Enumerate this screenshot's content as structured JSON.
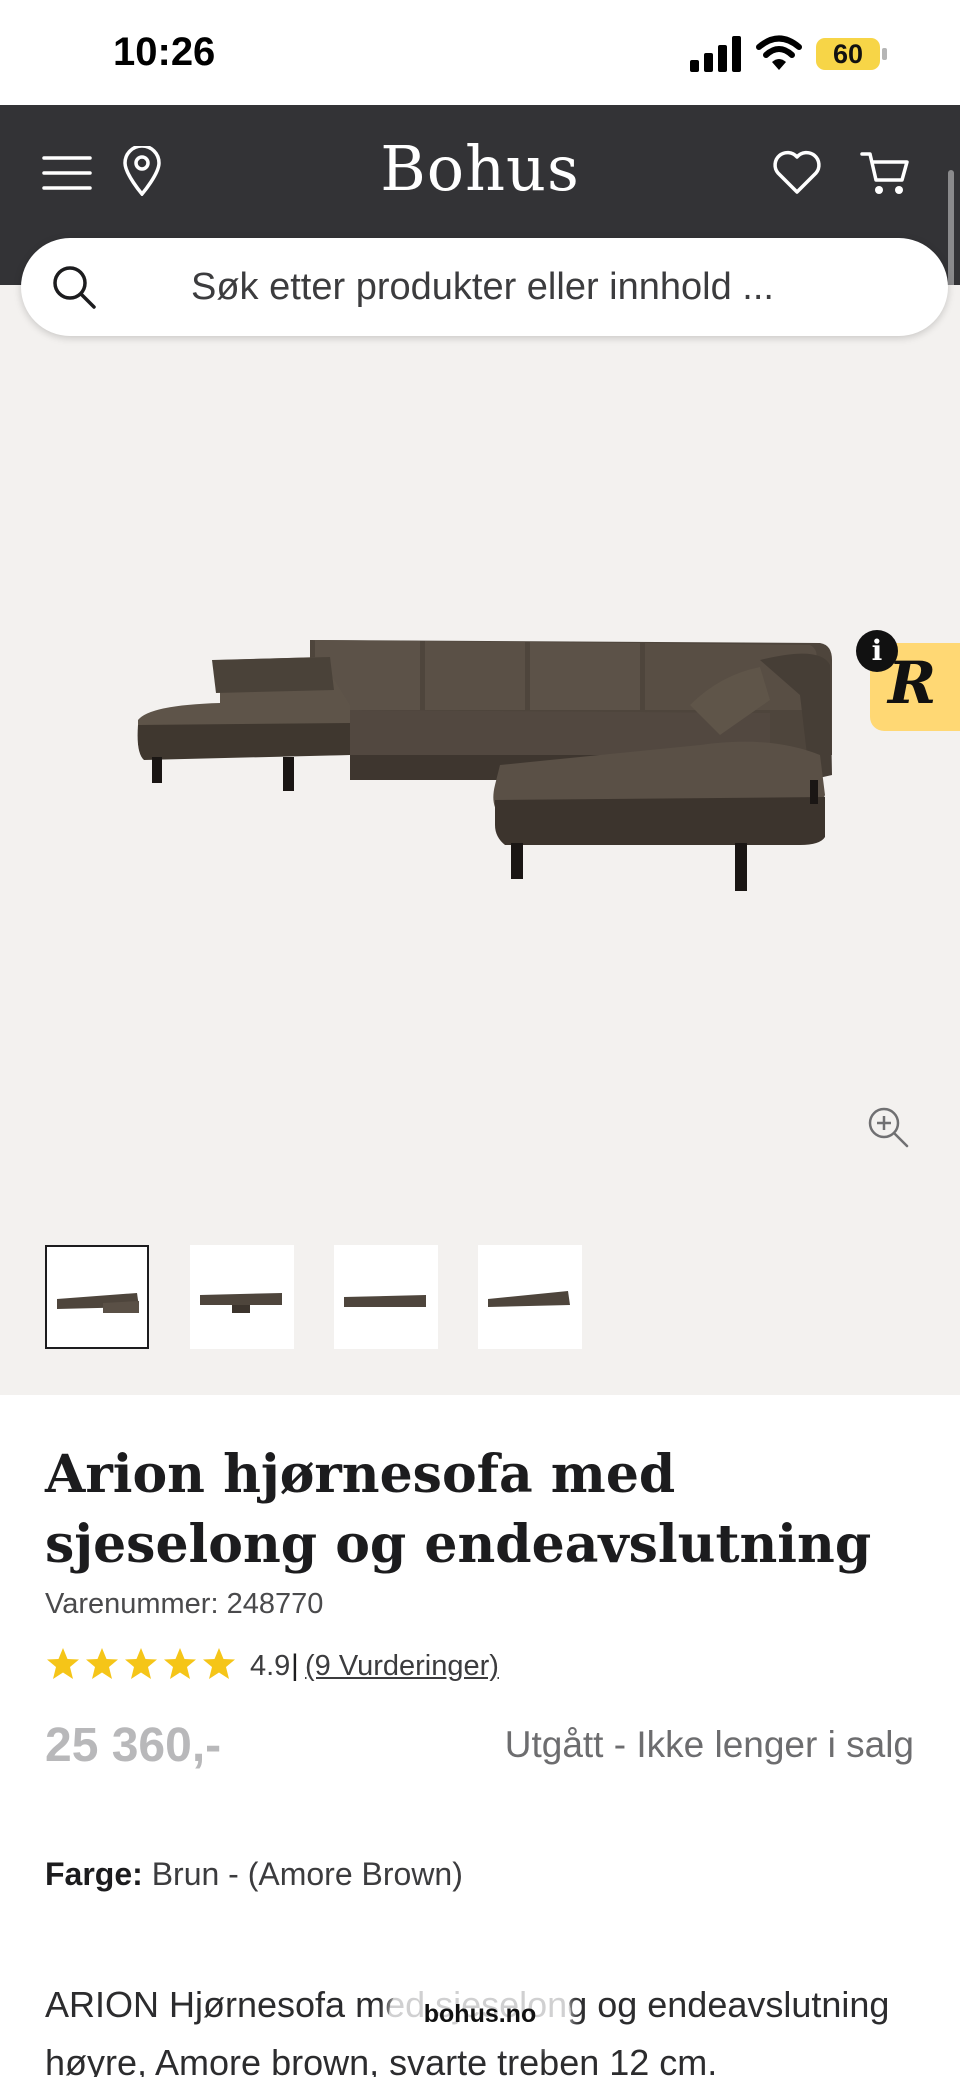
{
  "status_bar": {
    "time": "10:26",
    "battery": "60"
  },
  "header": {
    "logo": "Bohus"
  },
  "search": {
    "placeholder": "Søk etter produkter eller innhold ..."
  },
  "gallery": {
    "thumbnail_count": 4,
    "active_thumbnail": 1
  },
  "product": {
    "title": "Arion hjørnesofa med sjeselong og endeavslutning",
    "sku_label": "Varenummer:",
    "sku": "248770",
    "rating": "4.9",
    "rating_separator": "|",
    "reviews_link": "(9 Vurderinger)",
    "stars_filled": 5,
    "price": "25 360,-",
    "availability": "Utgått - Ikke lenger i salg",
    "color_label": "Farge:",
    "color_value": "Brun - (Amore Brown)",
    "description": "ARION Hjørnesofa med sjeselong og endeavslutning høyre, Amore brown, svarte treben 12 cm."
  },
  "browser": {
    "url": "bohus.no"
  },
  "colors": {
    "header_bg": "#333336",
    "gallery_bg": "#f3f1ef",
    "star": "#f5c518",
    "retail_badge": "#ffd874"
  }
}
